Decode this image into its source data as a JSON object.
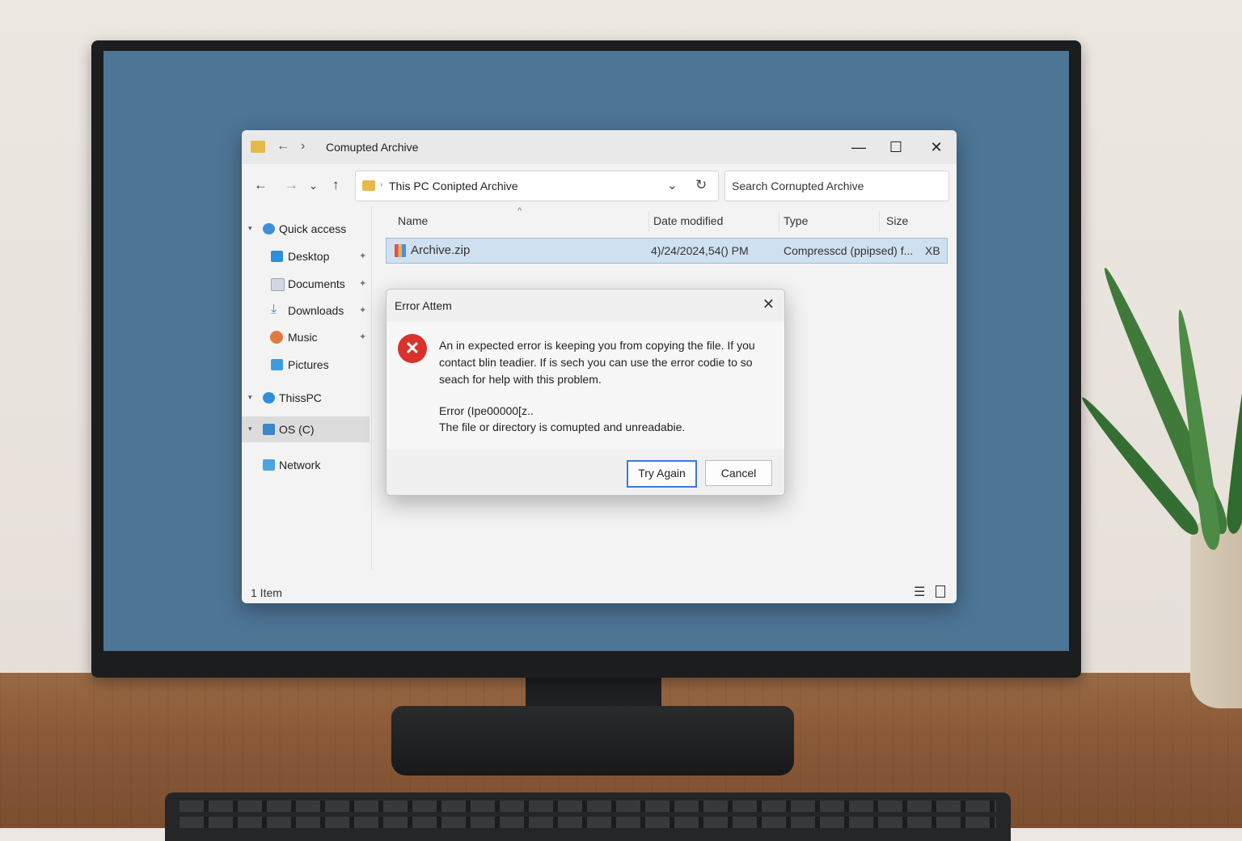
{
  "window": {
    "title": "Comupted Archive",
    "address_path": "This PC Conipted Archive",
    "search_placeholder": "Search Cornupted Archive",
    "status": "1 Item"
  },
  "sidebar": {
    "items": [
      {
        "label": "Quick access"
      },
      {
        "label": "Desktop"
      },
      {
        "label": "Documents"
      },
      {
        "label": "Downloads"
      },
      {
        "label": "Music"
      },
      {
        "label": "Pictures"
      },
      {
        "label": "ThissPC"
      },
      {
        "label": "OS (C)"
      },
      {
        "label": "Network"
      }
    ]
  },
  "file_list": {
    "columns": [
      "Name",
      "Date modified",
      "Type",
      "Size"
    ],
    "rows": [
      {
        "name": "Archive.zip",
        "date": "4)/24/2024,54() PM",
        "type": "Compresscd (ppipsed) f...",
        "size": "XB"
      }
    ]
  },
  "dialog": {
    "title": "Error Attem",
    "message": "An in expected error is keeping you from copying the file. If you contact blin teadier. If is sech you can use the error codie to so seach for help with this problem.",
    "error_code": "Error (Ipe00000[z..",
    "error_detail": "The file or directory is comupted and unreadabie.",
    "buttons": {
      "primary": "Try Again",
      "secondary": "Cancel"
    }
  },
  "icons": {
    "window_folder": "folder-icon",
    "error": "error-x-icon",
    "accent": "#3a7bd5",
    "error_color": "#d8322b"
  }
}
